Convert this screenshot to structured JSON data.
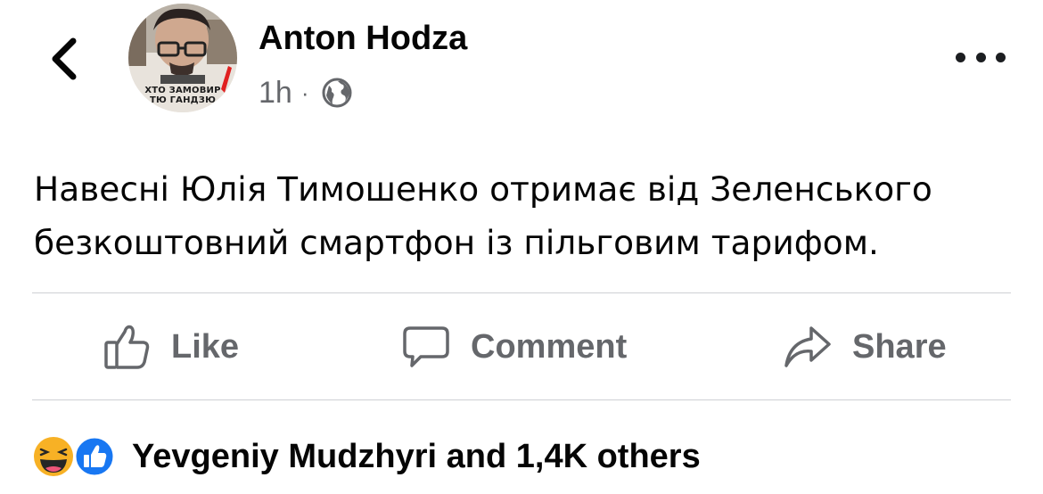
{
  "post": {
    "author": "Anton Hodza",
    "time": "1h",
    "separator": "·",
    "privacy_icon": "globe-icon",
    "avatar_caption_line1": "ХТО ЗАМОВИР",
    "avatar_caption_line2": "ТЮ ГАНДЗЮ",
    "text_lines": [
      "Навесні Юлія Тимошенко отримає від Зеленського",
      "безкоштовний смартфон із пільговим тарифом."
    ]
  },
  "actions": {
    "like": "Like",
    "comment": "Comment",
    "share": "Share"
  },
  "reactions": {
    "icons": [
      "haha-icon",
      "like-reaction-icon"
    ],
    "summary": "Yevgeniy Mudzhyri and 1,4K others"
  },
  "colors": {
    "text": "#050505",
    "secondary": "#65676b",
    "like_blue": "#1877f2",
    "haha_yellow": "#f7b125",
    "divider": "#ced0d4"
  }
}
